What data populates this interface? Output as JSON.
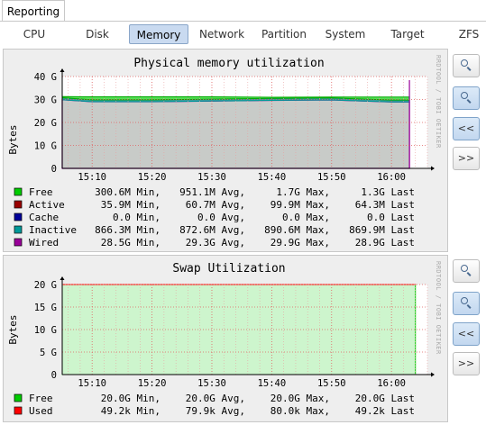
{
  "top_tab": {
    "label": "Reporting"
  },
  "subtabs": [
    "CPU",
    "Disk",
    "Memory",
    "Network",
    "Partition",
    "System",
    "Target",
    "ZFS"
  ],
  "active_subtab": "Memory",
  "buttons": {
    "back": "<<",
    "forward": ">>",
    "zoom_in_icon": "zoom-in-icon",
    "zoom_out_icon": "zoom-out-icon"
  },
  "side_label": "RRDTOOL / TOBI OETIKER",
  "memory_chart": {
    "title": "Physical memory utilization",
    "ylabel": "Bytes",
    "yticks": [
      "0",
      "10 G",
      "20 G",
      "30 G",
      "40 G"
    ],
    "xticks": [
      "15:10",
      "15:20",
      "15:30",
      "15:40",
      "15:50",
      "16:00"
    ],
    "legend_headers": [
      "Min,",
      "Avg,",
      "Max,",
      "Last"
    ],
    "legend": [
      {
        "color": "#00cc00",
        "name": "Free",
        "min": "300.6M Min,",
        "avg": "951.1M Avg,",
        "max": "1.7G Max,",
        "last": "1.3G Last"
      },
      {
        "color": "#990000",
        "name": "Active",
        "min": "35.9M Min,",
        "avg": "60.7M Avg,",
        "max": "99.9M Max,",
        "last": "64.3M Last"
      },
      {
        "color": "#000099",
        "name": "Cache",
        "min": "0.0 Min,",
        "avg": "0.0 Avg,",
        "max": "0.0 Max,",
        "last": "0.0 Last"
      },
      {
        "color": "#009999",
        "name": "Inactive",
        "min": "866.3M Min,",
        "avg": "872.6M Avg,",
        "max": "890.6M Max,",
        "last": "869.9M Last"
      },
      {
        "color": "#990099",
        "name": "Wired",
        "min": "28.5G Min,",
        "avg": "29.3G Avg,",
        "max": "29.9G Max,",
        "last": "28.9G Last"
      }
    ]
  },
  "swap_chart": {
    "title": "Swap Utilization",
    "ylabel": "Bytes",
    "yticks": [
      "0",
      "5 G",
      "10 G",
      "15 G",
      "20 G"
    ],
    "xticks": [
      "15:10",
      "15:20",
      "15:30",
      "15:40",
      "15:50",
      "16:00"
    ],
    "legend": [
      {
        "color": "#00cc00",
        "name": "Free",
        "min": "20.0G Min,",
        "avg": "20.0G Avg,",
        "max": "20.0G Max,",
        "last": "20.0G Last"
      },
      {
        "color": "#ff0000",
        "name": "Used",
        "min": "49.2k Min,",
        "avg": "79.9k Avg,",
        "max": "80.0k Max,",
        "last": "49.2k Last"
      }
    ]
  },
  "chart_data": [
    {
      "type": "area",
      "title": "Physical memory utilization",
      "ylabel": "Bytes",
      "xlabel": "",
      "ylim": [
        0,
        40
      ],
      "y_unit": "G",
      "x": [
        "15:05",
        "15:10",
        "15:20",
        "15:30",
        "15:40",
        "15:50",
        "16:00",
        "16:03"
      ],
      "series": [
        {
          "name": "Wired",
          "values": [
            29.9,
            29.0,
            29.0,
            29.3,
            29.6,
            29.8,
            28.9,
            28.9
          ]
        },
        {
          "name": "Inactive",
          "values": [
            0.87,
            0.87,
            0.87,
            0.87,
            0.87,
            0.87,
            0.87,
            0.87
          ]
        },
        {
          "name": "Free",
          "values": [
            0.5,
            1.3,
            1.3,
            1.0,
            0.5,
            0.4,
            1.3,
            1.3
          ]
        }
      ],
      "grid": true
    },
    {
      "type": "area",
      "title": "Swap Utilization",
      "ylabel": "Bytes",
      "xlabel": "",
      "ylim": [
        0,
        20
      ],
      "y_unit": "G",
      "x": [
        "15:05",
        "15:10",
        "15:20",
        "15:30",
        "15:40",
        "15:50",
        "16:00",
        "16:04"
      ],
      "series": [
        {
          "name": "Free",
          "values": [
            20.0,
            20.0,
            20.0,
            20.0,
            20.0,
            20.0,
            20.0,
            20.0
          ]
        },
        {
          "name": "Used",
          "values": [
            8e-05,
            8e-05,
            8e-05,
            8e-05,
            8e-05,
            8e-05,
            5e-05,
            5e-05
          ]
        }
      ],
      "grid": true
    }
  ]
}
